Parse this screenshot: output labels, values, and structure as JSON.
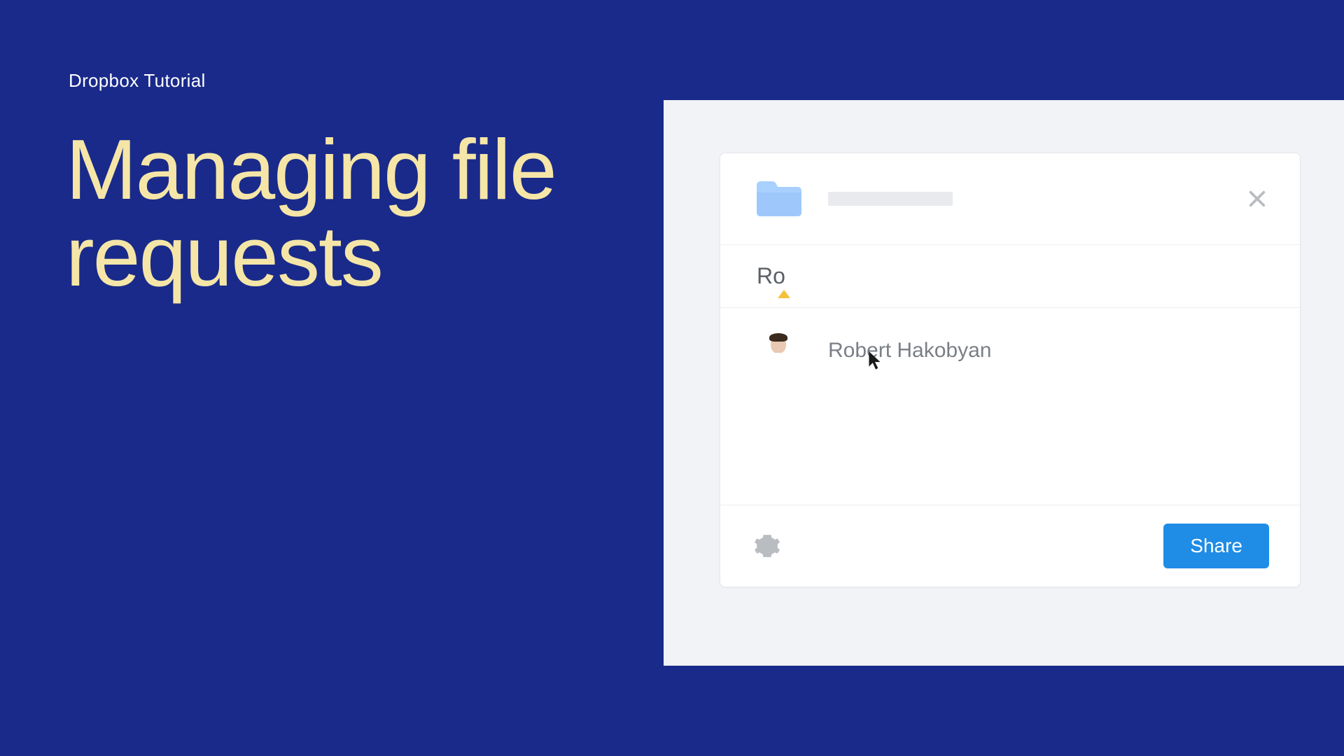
{
  "breadcrumb": "Dropbox Tutorial",
  "heading_line1": "Managing file",
  "heading_line2": "requests",
  "dialog": {
    "search_value": "Ro",
    "suggestion_name": "Robert Hakobyan",
    "share_label": "Share"
  }
}
